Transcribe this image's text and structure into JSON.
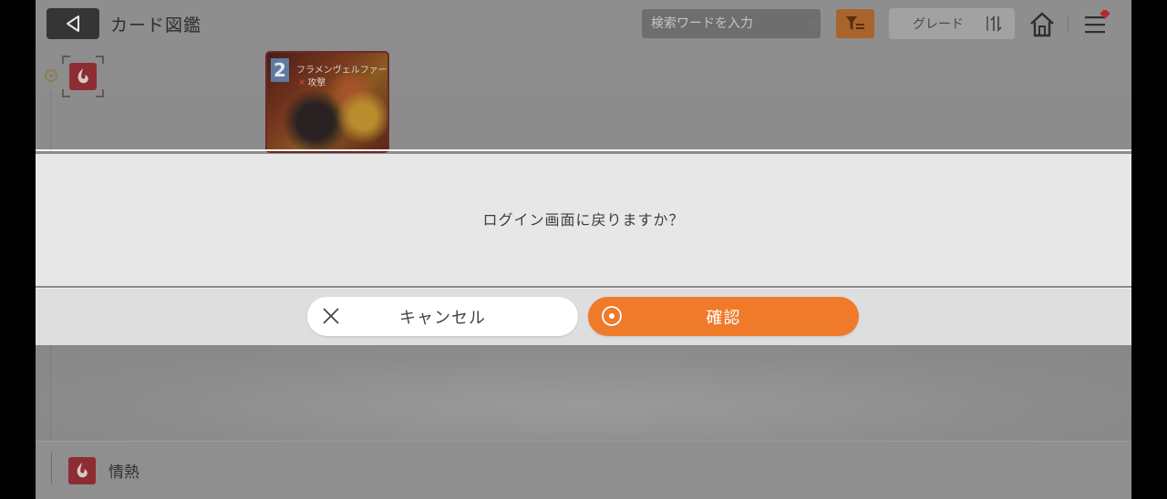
{
  "header": {
    "title": "カード図鑑",
    "search_placeholder": "検索ワードを入力",
    "grade_label": "グレード"
  },
  "card": {
    "grade": "2",
    "name": "フラメンヴェルファー",
    "type": "攻撃"
  },
  "bottom_bar": {
    "attribute_label": "情熱"
  },
  "dialog": {
    "message": "ログイン画面に戻りますか？",
    "cancel_label": "キャンセル",
    "confirm_label": "確認"
  },
  "colors": {
    "accent_orange": "#ef7a2a",
    "attribute_red": "#8e2c33",
    "dialog_bg": "#e7e7e7"
  },
  "icons": [
    "back-arrow-icon",
    "search-icon",
    "filter-icon",
    "sort-icon",
    "home-icon",
    "menu-icon",
    "notification-badge-icon",
    "passion-attribute-icon",
    "close-icon",
    "confirm-circle-icon"
  ]
}
